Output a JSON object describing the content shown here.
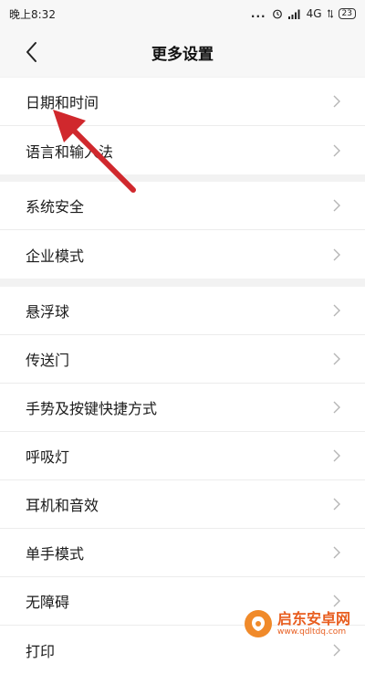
{
  "status_bar": {
    "time": "晚上8:32",
    "signal_dots": "...",
    "network": "4G",
    "battery": "23"
  },
  "header": {
    "title": "更多设置"
  },
  "groups": [
    {
      "items": [
        {
          "label": "日期和时间"
        },
        {
          "label": "语言和输入法"
        }
      ]
    },
    {
      "items": [
        {
          "label": "系统安全"
        },
        {
          "label": "企业模式"
        }
      ]
    },
    {
      "items": [
        {
          "label": "悬浮球"
        },
        {
          "label": "传送门"
        },
        {
          "label": "手势及按键快捷方式"
        },
        {
          "label": "呼吸灯"
        },
        {
          "label": "耳机和音效"
        },
        {
          "label": "单手模式"
        },
        {
          "label": "无障碍"
        },
        {
          "label": "打印"
        }
      ]
    }
  ],
  "annotation": {
    "color": "#d0282d"
  },
  "watermark": {
    "name": "启东安卓网",
    "url": "www.qdltdq.com"
  }
}
